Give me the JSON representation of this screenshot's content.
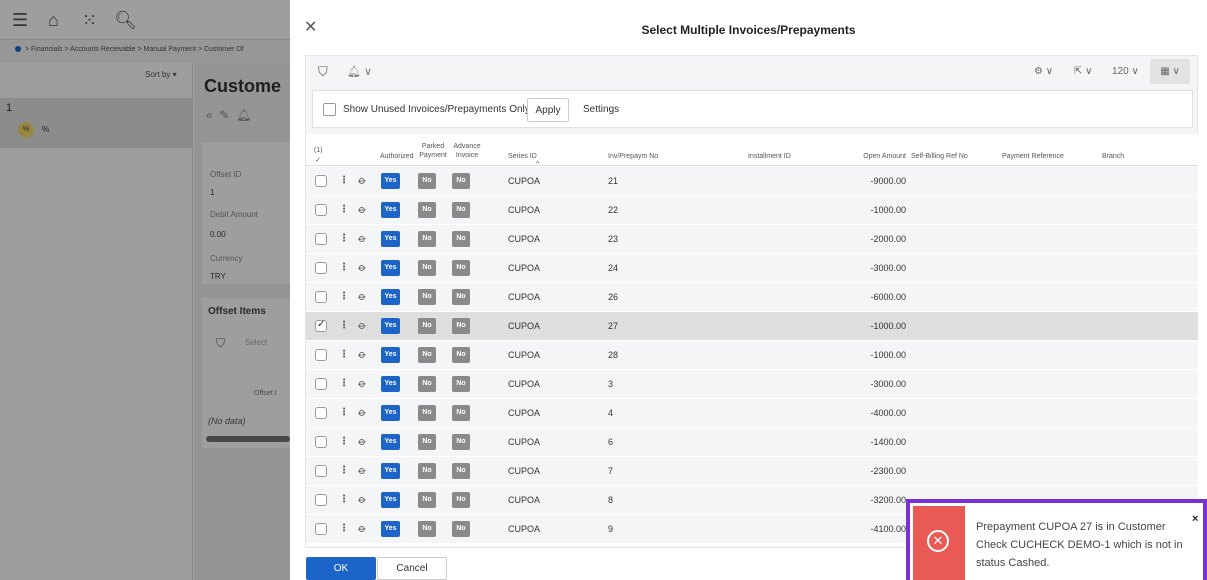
{
  "background": {
    "breadcrumb": "> Financials > Accounts Receivable > Manual Payment > Customer Of",
    "sort_label": "Sort by ▾",
    "list_item_number": "1",
    "list_badge": "%",
    "list_badge_text": "%",
    "page_title": "Custome",
    "fields": [
      {
        "label": "Offset ID",
        "value": "1"
      },
      {
        "label": "Debit Amount",
        "value": "0.00"
      },
      {
        "label": "Currency",
        "value": "TRY"
      }
    ],
    "offset_items_title": "Offset Items",
    "select_text": "Select",
    "offset_col": "Offset I",
    "no_data": "(No data)"
  },
  "dialog": {
    "title": "Select Multiple Invoices/Prepayments",
    "page_size": "120 ∨",
    "options": {
      "show_unused_label": "Show Unused Invoices/Prepayments Only",
      "apply_label": "Apply",
      "settings_label": "Settings"
    },
    "selected_count": "(1)",
    "columns": {
      "authorized": "Authorized",
      "parked_1": "Parked",
      "parked_2": "Payment",
      "advance_1": "Advance",
      "advance_2": "Invoice",
      "series_id": "Series ID",
      "inv_no": "Inv/Prepaym No",
      "installment_id": "Installment ID",
      "open_amount": "Open Amount",
      "self_billing": "Self-Billing Ref No",
      "payment_ref": "Payment Reference",
      "branch": "Branch"
    },
    "badge_yes": "Yes",
    "badge_no": "No",
    "rows": [
      {
        "series": "CUPOA",
        "no": "21",
        "amount": "-9000.00"
      },
      {
        "series": "CUPOA",
        "no": "22",
        "amount": "-1000.00"
      },
      {
        "series": "CUPOA",
        "no": "23",
        "amount": "-2000.00"
      },
      {
        "series": "CUPOA",
        "no": "24",
        "amount": "-3000.00"
      },
      {
        "series": "CUPOA",
        "no": "26",
        "amount": "-6000.00"
      },
      {
        "series": "CUPOA",
        "no": "27",
        "amount": "-1000.00"
      },
      {
        "series": "CUPOA",
        "no": "28",
        "amount": "-1000.00"
      },
      {
        "series": "CUPOA",
        "no": "3",
        "amount": "-3000.00"
      },
      {
        "series": "CUPOA",
        "no": "4",
        "amount": "-4000.00"
      },
      {
        "series": "CUPOA",
        "no": "6",
        "amount": "-1400.00"
      },
      {
        "series": "CUPOA",
        "no": "7",
        "amount": "-2300.00"
      },
      {
        "series": "CUPOA",
        "no": "8",
        "amount": "-3200.00"
      },
      {
        "series": "CUPOA",
        "no": "9",
        "amount": "-4100.00"
      }
    ],
    "selected_row_index": 5,
    "ok_label": "OK",
    "cancel_label": "Cancel"
  },
  "toast": {
    "message": "Prepayment CUPOA 27 is in Customer Check CUCHECK DEMO-1 which is not in status Cashed.",
    "close": "×"
  },
  "colors": {
    "primary": "#1d64c9",
    "badge_no": "#8a8a8a",
    "error": "#e85a53",
    "highlight_border": "#7b2fd4"
  }
}
